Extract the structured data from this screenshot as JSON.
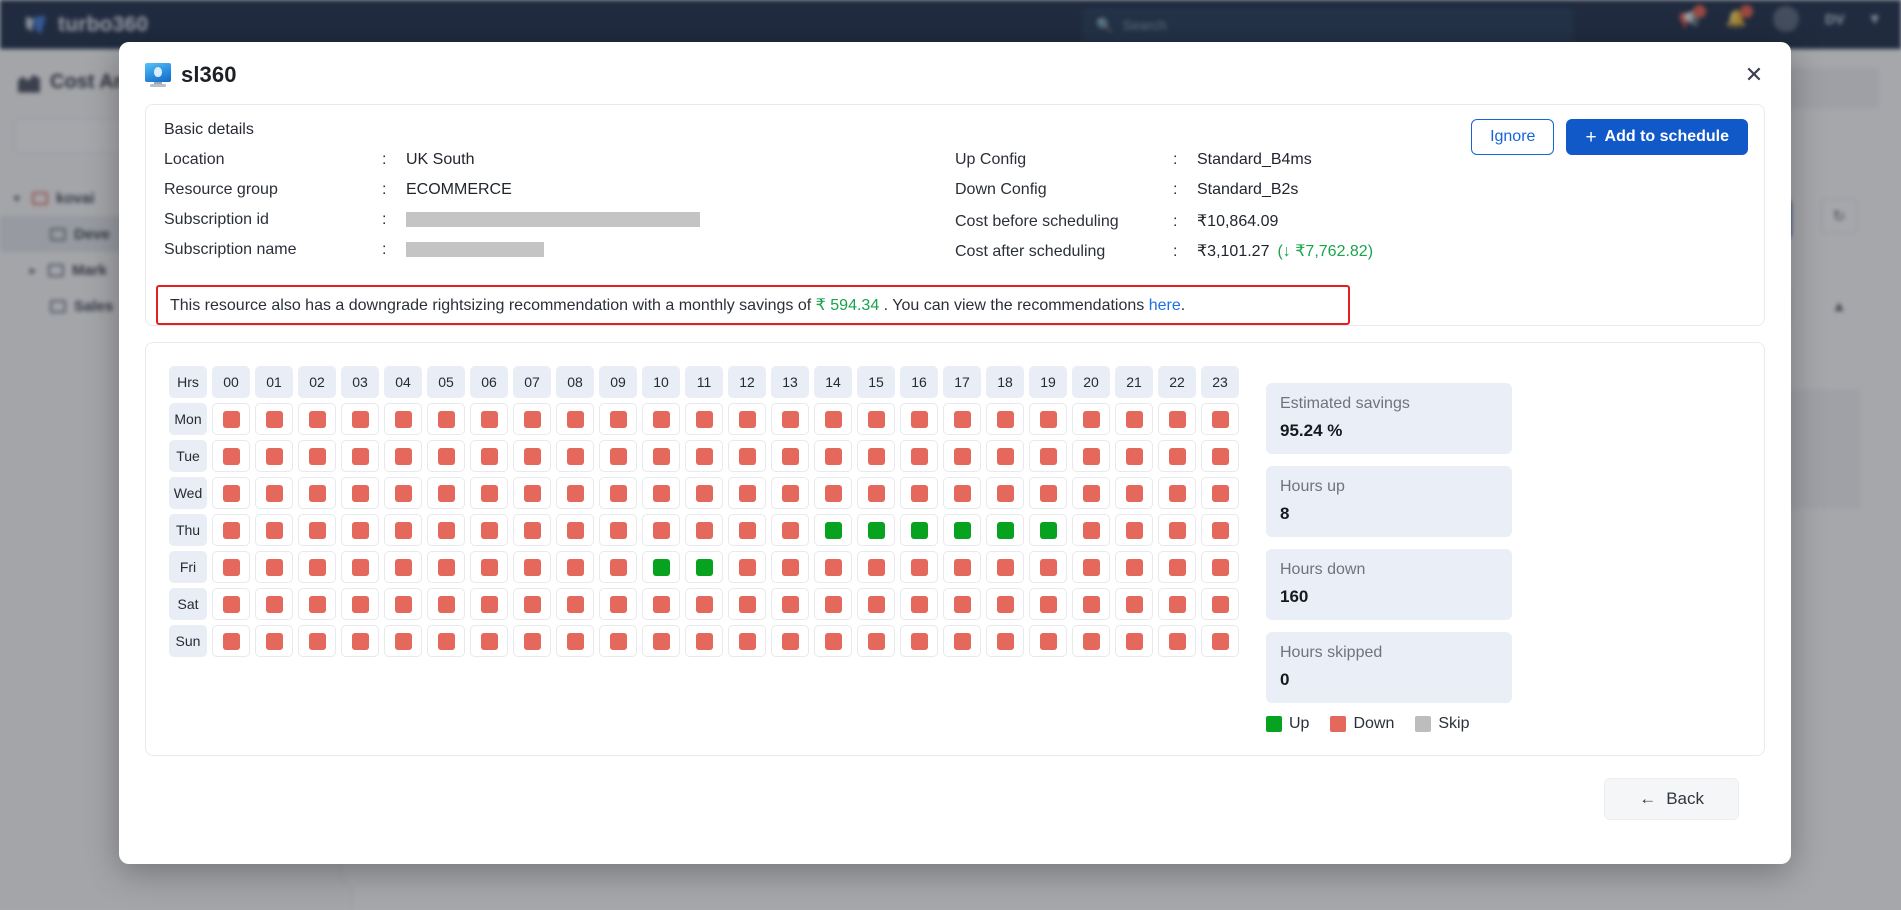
{
  "app": {
    "brand": "turbo360",
    "search_placeholder": "Search",
    "search_value": "",
    "user_initials": "DV",
    "sidebar_title": "Cost Ana",
    "tree": [
      {
        "label": "kovai",
        "level": 1,
        "selected": false
      },
      {
        "label": "Deve",
        "level": 2,
        "selected": true
      },
      {
        "label": "Mark",
        "level": 2,
        "selected": false
      },
      {
        "label": "Sales",
        "level": 2,
        "selected": false
      }
    ]
  },
  "modal": {
    "title": "sl360",
    "icon": "virtual-machine-icon",
    "close_label": "✕",
    "basic": {
      "heading": "Basic details",
      "ignore_label": "Ignore",
      "add_label": "Add to schedule",
      "add_plus": "+",
      "left_rows": [
        {
          "key": "Location",
          "value": "UK South",
          "redacted": ""
        },
        {
          "key": "Resource group",
          "value": "ECOMMERCE",
          "redacted": ""
        },
        {
          "key": "Subscription id",
          "value": "",
          "redacted": "long"
        },
        {
          "key": "Subscription name",
          "value": "",
          "redacted": "short"
        }
      ],
      "right_rows": [
        {
          "key": "Up Config",
          "value": "Standard_B4ms",
          "extra": ""
        },
        {
          "key": "Down Config",
          "value": "Standard_B2s",
          "extra": ""
        },
        {
          "key": "Cost before scheduling",
          "value": "₹10,864.09",
          "extra": ""
        },
        {
          "key": "Cost after scheduling",
          "value": "₹3,101.27",
          "extra": "(↓ ₹7,762.82)"
        }
      ]
    },
    "alert": {
      "text_before": "This resource also has a downgrade rightsizing recommendation with a monthly savings of ",
      "amount": "₹ 594.34",
      "text_mid": " . You can view the recommendations ",
      "link": "here",
      "text_after": "."
    },
    "schedule": {
      "corner_label": "Hrs",
      "hours": [
        "00",
        "01",
        "02",
        "03",
        "04",
        "05",
        "06",
        "07",
        "08",
        "09",
        "10",
        "11",
        "12",
        "13",
        "14",
        "15",
        "16",
        "17",
        "18",
        "19",
        "20",
        "21",
        "22",
        "23"
      ],
      "days": [
        "Mon",
        "Tue",
        "Wed",
        "Thu",
        "Fri",
        "Sat",
        "Sun"
      ],
      "cells": [
        [
          "down",
          "down",
          "down",
          "down",
          "down",
          "down",
          "down",
          "down",
          "down",
          "down",
          "down",
          "down",
          "down",
          "down",
          "down",
          "down",
          "down",
          "down",
          "down",
          "down",
          "down",
          "down",
          "down",
          "down"
        ],
        [
          "down",
          "down",
          "down",
          "down",
          "down",
          "down",
          "down",
          "down",
          "down",
          "down",
          "down",
          "down",
          "down",
          "down",
          "down",
          "down",
          "down",
          "down",
          "down",
          "down",
          "down",
          "down",
          "down",
          "down"
        ],
        [
          "down",
          "down",
          "down",
          "down",
          "down",
          "down",
          "down",
          "down",
          "down",
          "down",
          "down",
          "down",
          "down",
          "down",
          "down",
          "down",
          "down",
          "down",
          "down",
          "down",
          "down",
          "down",
          "down",
          "down"
        ],
        [
          "down",
          "down",
          "down",
          "down",
          "down",
          "down",
          "down",
          "down",
          "down",
          "down",
          "down",
          "down",
          "down",
          "down",
          "up",
          "up",
          "up",
          "up",
          "up",
          "up",
          "down",
          "down",
          "down",
          "down"
        ],
        [
          "down",
          "down",
          "down",
          "down",
          "down",
          "down",
          "down",
          "down",
          "down",
          "down",
          "up",
          "up",
          "down",
          "down",
          "down",
          "down",
          "down",
          "down",
          "down",
          "down",
          "down",
          "down",
          "down",
          "down"
        ],
        [
          "down",
          "down",
          "down",
          "down",
          "down",
          "down",
          "down",
          "down",
          "down",
          "down",
          "down",
          "down",
          "down",
          "down",
          "down",
          "down",
          "down",
          "down",
          "down",
          "down",
          "down",
          "down",
          "down",
          "down"
        ],
        [
          "down",
          "down",
          "down",
          "down",
          "down",
          "down",
          "down",
          "down",
          "down",
          "down",
          "down",
          "down",
          "down",
          "down",
          "down",
          "down",
          "down",
          "down",
          "down",
          "down",
          "down",
          "down",
          "down",
          "down"
        ]
      ]
    },
    "stats": [
      {
        "label": "Estimated savings",
        "value": "95.24 %"
      },
      {
        "label": "Hours up",
        "value": "8"
      },
      {
        "label": "Hours down",
        "value": "160"
      },
      {
        "label": "Hours skipped",
        "value": "0"
      }
    ],
    "legend": [
      {
        "label": "Up",
        "color": "#07a320",
        "key": "up"
      },
      {
        "label": "Down",
        "color": "#e4685c",
        "key": "down"
      },
      {
        "label": "Skip",
        "color": "#bdbdbd",
        "key": "skip"
      }
    ],
    "back_label": "Back",
    "back_arrow": "←"
  },
  "colors": {
    "primary": "#1158c9",
    "up": "#07a320",
    "down": "#e4685c",
    "skip": "#bdbdbd",
    "alert_border": "#e81e1e",
    "savings_green": "#16a34a",
    "nav_bg": "#081b39"
  }
}
